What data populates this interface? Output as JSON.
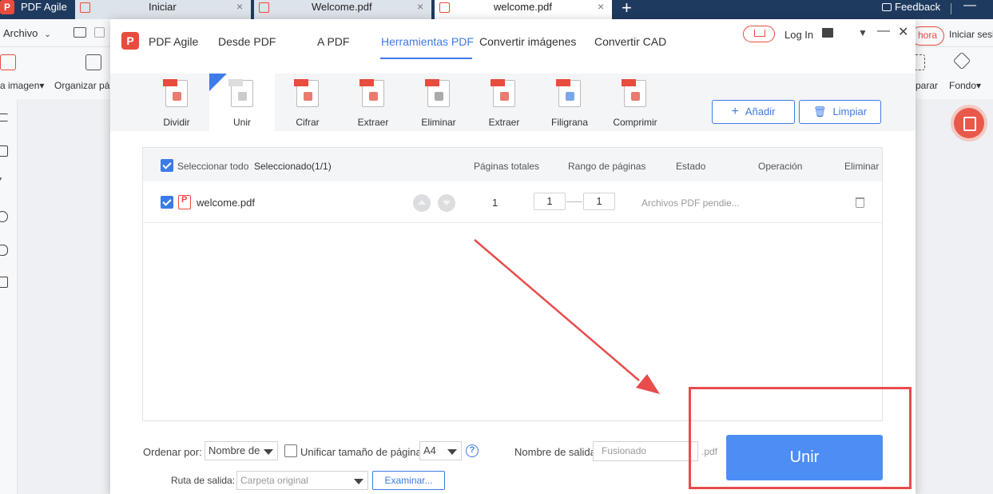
{
  "tabbar": {
    "app_name": "PDF Agile",
    "tabs": [
      {
        "label": "Iniciar",
        "icon": "home-icon"
      },
      {
        "label": "Welcome.pdf",
        "icon": "pdf-file-icon"
      },
      {
        "label": "welcome.pdf",
        "icon": "pdf-file-icon",
        "active": true
      }
    ],
    "close_glyph": "×",
    "new_tab_glyph": "+",
    "feedback": "Feedback",
    "minimize_glyph": "—"
  },
  "background_app": {
    "menu": "Archivo",
    "menu_caret": "⌄",
    "tools": [
      {
        "label": "a imagen",
        "icon": "image-icon"
      },
      {
        "label": "Organizar pá",
        "icon": "organize-pages-icon"
      },
      {
        "label": "parar",
        "icon": "compare-icon"
      },
      {
        "label": "Fondo",
        "icon": "paint-bucket-icon"
      }
    ],
    "dropdown_caret": "▾",
    "login_badge": "hora",
    "signin": "Iniciar sesi"
  },
  "dialog": {
    "app_name": "PDF Agile",
    "logo_glyph": "P",
    "nav": [
      {
        "label": "Desde PDF"
      },
      {
        "label": "A PDF"
      },
      {
        "label": "Herramientas PDF",
        "active": true
      },
      {
        "label": "Convertir imágenes"
      },
      {
        "label": "Convertir CAD"
      }
    ],
    "login": "Log In",
    "ctrl_glyphs": {
      "menu": "▼",
      "minimize": "—",
      "close": "✕"
    },
    "tools": [
      {
        "label": "Dividir",
        "icon": "split-pdf-icon"
      },
      {
        "label": "Unir",
        "icon": "merge-pdf-icon",
        "active": true
      },
      {
        "label": "Cifrar",
        "icon": "encrypt-pdf-icon"
      },
      {
        "label": "Extraer",
        "icon": "extract-pages-icon"
      },
      {
        "label": "Eliminar",
        "icon": "delete-pages-icon"
      },
      {
        "label": "Extraer",
        "icon": "extract-images-icon"
      },
      {
        "label": "Filigrana",
        "icon": "watermark-icon"
      },
      {
        "label": "Comprimir",
        "icon": "compress-pdf-icon"
      }
    ],
    "add_button": "Añadir",
    "add_glyph": "+",
    "clear_button": "Limpiar",
    "clear_glyph": "🗑",
    "table": {
      "select_all": "Seleccionar todo",
      "selected": "Seleccionado(1/1)",
      "headers": {
        "total_pages": "Páginas totales",
        "page_range": "Rango de páginas",
        "status": "Estado",
        "operation": "Operación",
        "delete": "Eliminar"
      },
      "rows": [
        {
          "name": "welcome.pdf",
          "total_pages": "1",
          "range_from": "1",
          "range_to": "1",
          "status": "Archivos PDF pendie..."
        }
      ]
    },
    "bottom": {
      "sort_label": "Ordenar por:",
      "sort_value": "Nombre de",
      "unify_label": "Unificar tamaño de página",
      "page_size": "A4",
      "help_glyph": "?",
      "output_name_label": "Nombre de salida",
      "output_name_placeholder": "Fusionado",
      "output_suffix": ".pdf",
      "output_path_label": "Ruta de salida:",
      "output_path_value": "Carpeta original",
      "browse_button": "Examinar...",
      "merge_button": "Unir"
    }
  },
  "colors": {
    "accent": "#3d7be8",
    "brand": "#e84c3d",
    "primary_button": "#4d8ef5",
    "annotation": "#e84c4c"
  }
}
